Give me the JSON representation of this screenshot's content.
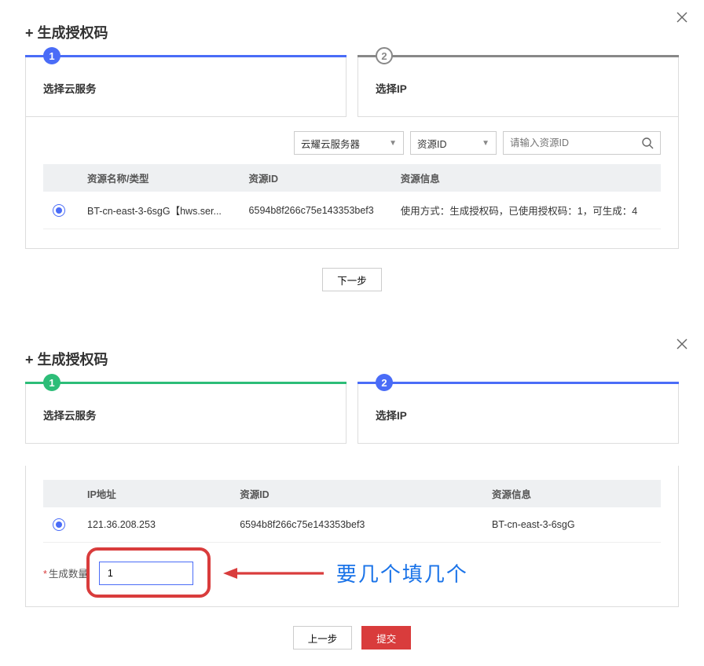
{
  "modal1": {
    "title": "+ 生成授权码",
    "steps": [
      {
        "num": "1",
        "label": "选择云服务"
      },
      {
        "num": "2",
        "label": "选择IP"
      }
    ],
    "filters": {
      "service_type": "云耀云服务器",
      "resource_key": "资源ID",
      "search_placeholder": "请输入资源ID"
    },
    "table": {
      "headers": {
        "name": "资源名称/类型",
        "id": "资源ID",
        "info": "资源信息"
      },
      "row": {
        "name": "BT-cn-east-3-6sgG【hws.ser...",
        "id": "6594b8f266c75e143353bef3",
        "info": "使用方式：生成授权码，已使用授权码：1，可生成：4"
      }
    },
    "buttons": {
      "next": "下一步"
    }
  },
  "modal2": {
    "title": "+ 生成授权码",
    "steps": [
      {
        "num": "1",
        "label": "选择云服务"
      },
      {
        "num": "2",
        "label": "选择IP"
      }
    ],
    "table": {
      "headers": {
        "ip": "IP地址",
        "id": "资源ID",
        "info": "资源信息"
      },
      "row": {
        "ip": "121.36.208.253",
        "id": "6594b8f266c75e143353bef3",
        "info": "BT-cn-east-3-6sgG"
      }
    },
    "form": {
      "qty_label": "生成数量",
      "qty_value": "1"
    },
    "annotation": "要几个填几个",
    "buttons": {
      "prev": "上一步",
      "submit": "提交"
    }
  }
}
